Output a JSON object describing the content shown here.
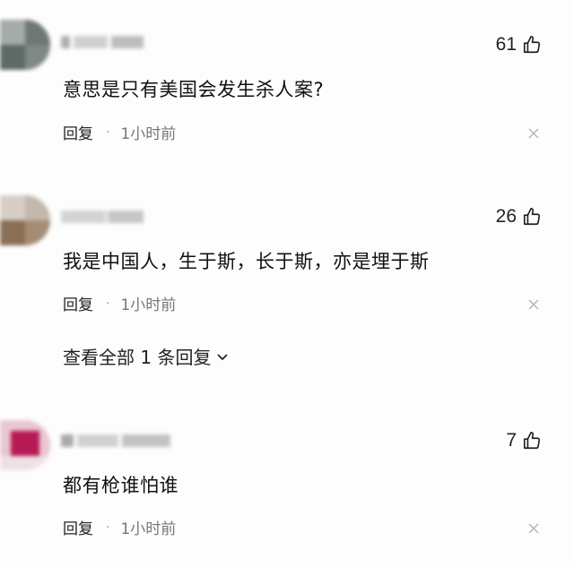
{
  "comments": [
    {
      "likes": "61",
      "text": "意思是只有美国会发生杀人案?",
      "reply_label": "回复",
      "time": "1小时前"
    },
    {
      "likes": "26",
      "text": "我是中国人，生于斯，长于斯，亦是埋于斯",
      "reply_label": "回复",
      "time": "1小时前",
      "view_all": "查看全部 1 条回复"
    },
    {
      "likes": "7",
      "text": "都有枪谁怕谁",
      "reply_label": "回复",
      "time": "1小时前"
    }
  ],
  "icons": {
    "like": "thumbs-up-icon",
    "close": "close-icon",
    "expand": "chevron-down-icon"
  },
  "colors": {
    "text": "#111111",
    "meta": "#777777",
    "background": "#fdfdfd"
  }
}
